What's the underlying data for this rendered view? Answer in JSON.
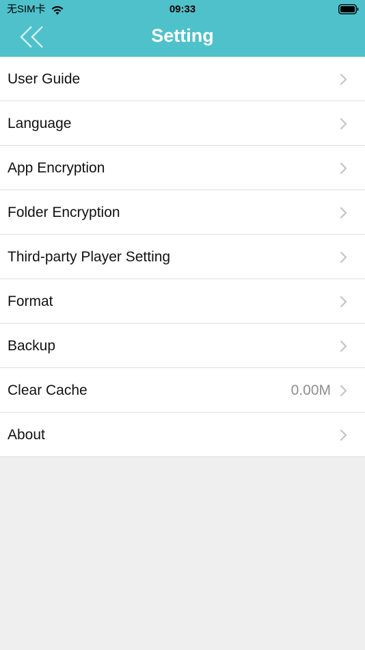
{
  "status_bar": {
    "carrier": "无SIM卡",
    "time": "09:33",
    "wifi_icon": "wifi-icon",
    "battery_icon": "battery-icon"
  },
  "nav": {
    "title": "Setting",
    "back_icon": "double-chevron-left-icon"
  },
  "settings": {
    "items": [
      {
        "label": "User Guide",
        "value": ""
      },
      {
        "label": "Language",
        "value": ""
      },
      {
        "label": "App Encryption",
        "value": ""
      },
      {
        "label": "Folder Encryption",
        "value": ""
      },
      {
        "label": "Third-party Player Setting",
        "value": ""
      },
      {
        "label": "Format",
        "value": ""
      },
      {
        "label": "Backup",
        "value": ""
      },
      {
        "label": "Clear Cache",
        "value": "0.00M"
      },
      {
        "label": "About",
        "value": ""
      }
    ],
    "chevron_icon": "chevron-right-icon"
  },
  "colors": {
    "header_bg": "#4fc1cb",
    "page_bg": "#efefef",
    "row_bg": "#ffffff",
    "separator": "#dedede",
    "chevron": "#c4c4c7",
    "secondary_text": "#8e8e93"
  }
}
